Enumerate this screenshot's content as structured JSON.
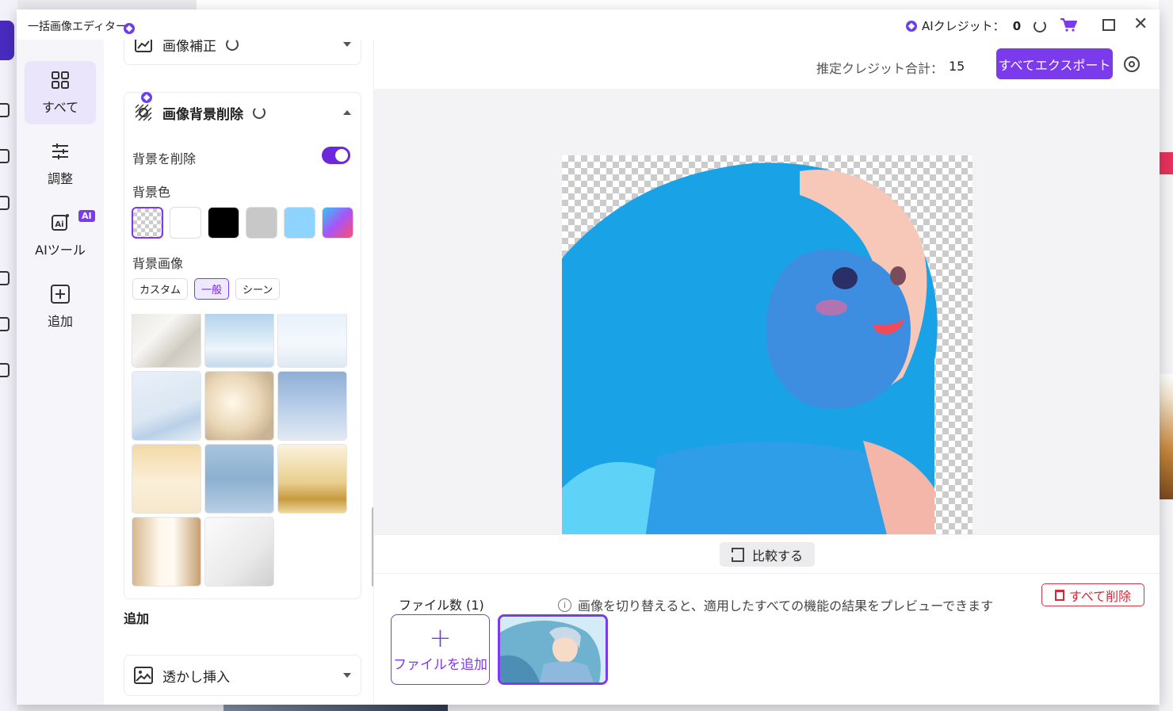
{
  "window": {
    "title": "一括画像エディター",
    "credit_label": "AIクレジット：",
    "credit_value": "0",
    "close_glyph": "✕"
  },
  "nav": {
    "items": [
      {
        "label": "すべて",
        "icon": "grid-icon",
        "active": true
      },
      {
        "label": "調整",
        "icon": "sliders-icon"
      },
      {
        "label": "AIツール",
        "icon": "ai-icon",
        "badge": "AI"
      },
      {
        "label": "追加",
        "icon": "plus-square-icon"
      }
    ]
  },
  "panel": {
    "prev_section_label": "画像補正",
    "bg_section_title": "画像背景削除",
    "remove_bg_label": "背景を削除",
    "remove_bg_enabled": true,
    "bg_color_label": "背景色",
    "bg_colors": [
      "transparent",
      "#ffffff",
      "#000000",
      "#c8c8c8",
      "#8fd3ff",
      "gradient"
    ],
    "bg_image_label": "背景画像",
    "bg_image_tabs": [
      "カスタム",
      "一般",
      "シーン"
    ],
    "bg_image_tab_active": "一般",
    "add_section_label": "追加",
    "watermark_label": "透かし挿入"
  },
  "main": {
    "est_credit_label": "推定クレジット合計：",
    "est_credit_value": "15",
    "export_all_label": "すべてエクスポート",
    "compare_label": "比較する",
    "file_count_label": "ファイル数 (1)",
    "info_text": "画像を切り替えると、適用したすべての機能の結果をプレビューできます",
    "delete_all_label": "すべて削除",
    "add_file_label": "ファイルを追加",
    "add_file_plus": "+"
  },
  "colors": {
    "accent": "#7c3aed",
    "danger": "#d9263a"
  }
}
